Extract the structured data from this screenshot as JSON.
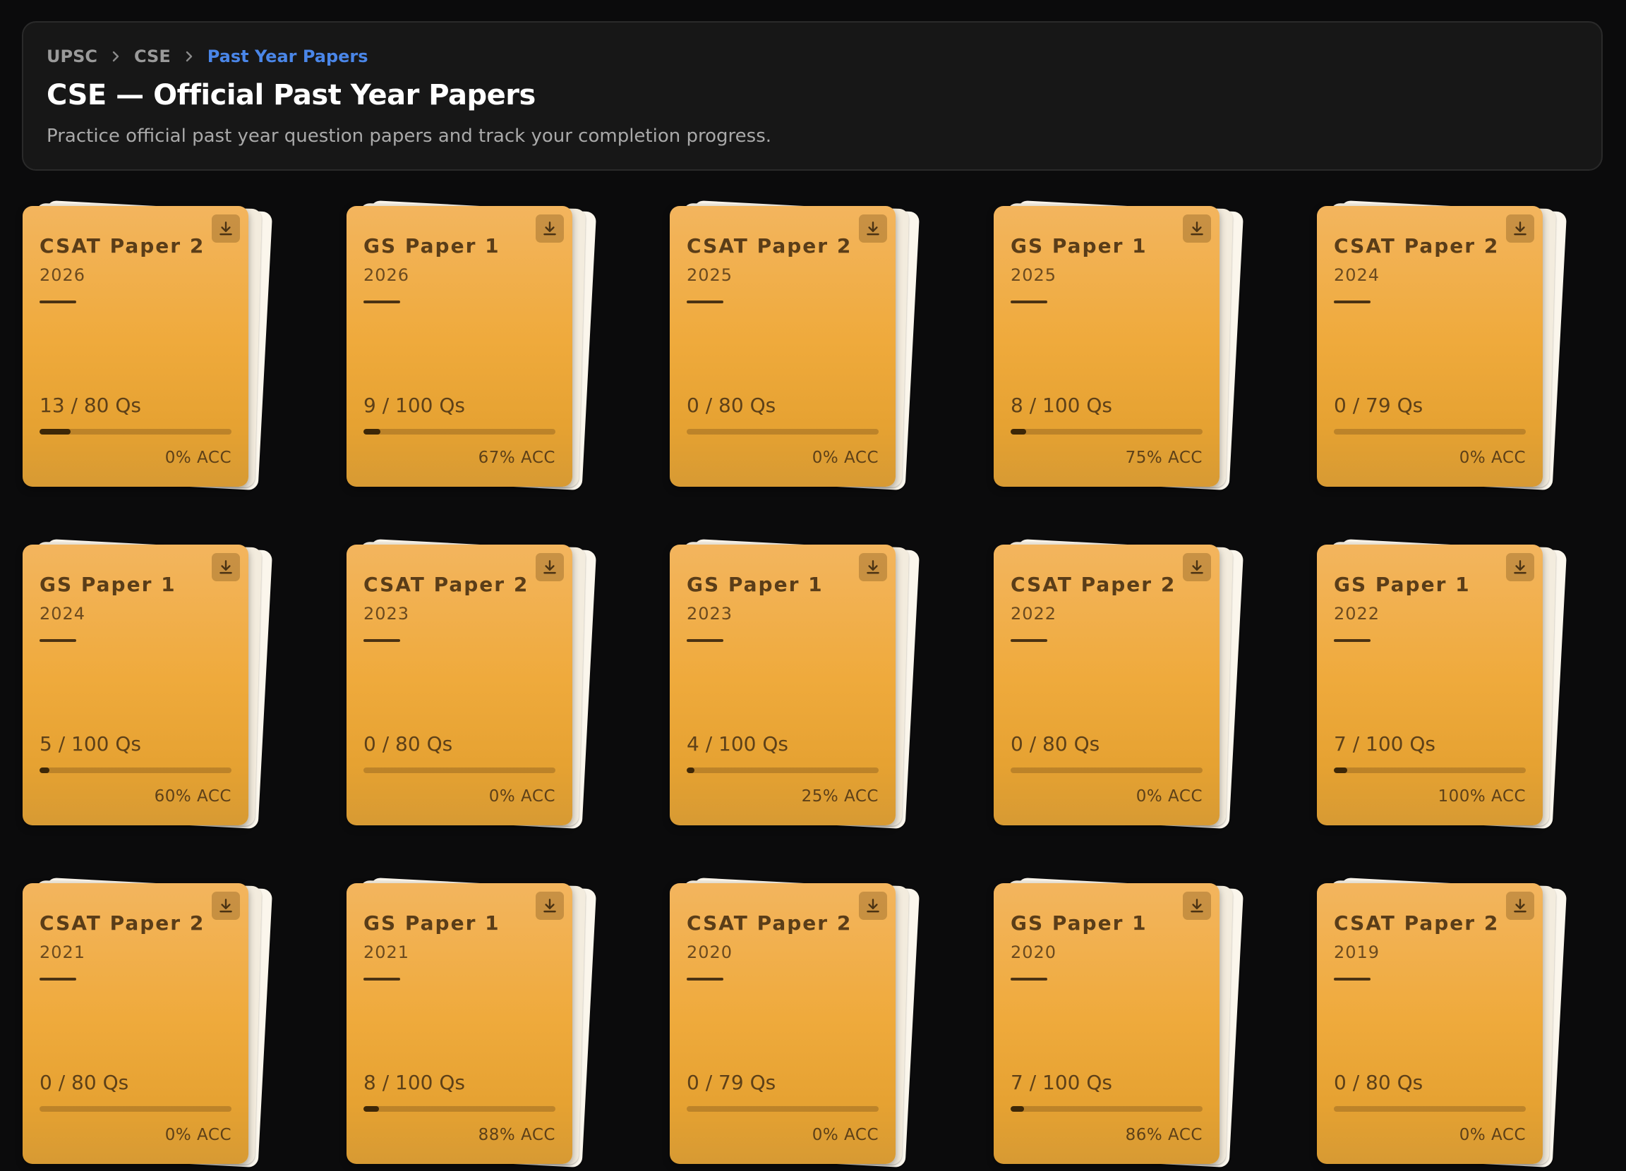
{
  "breadcrumb": [
    "UPSC",
    "CSE",
    "Past Year Papers"
  ],
  "page": {
    "title": "CSE — Official Past Year Papers",
    "subtitle": "Practice official past year question papers and track your completion progress."
  },
  "colors": {
    "accent": "#4a86e8",
    "card": "#efaa3c",
    "background": "#0b0b0c"
  },
  "icons": {
    "breadcrumb_separator": "chevron-right-icon",
    "download": "download-icon"
  },
  "papers": [
    {
      "name": "CSAT Paper 2",
      "year": "2026",
      "attempted": 13,
      "total": 80,
      "questions": "13 / 80 Qs",
      "accuracy": "0% ACC"
    },
    {
      "name": "GS Paper 1",
      "year": "2026",
      "attempted": 9,
      "total": 100,
      "questions": "9 / 100 Qs",
      "accuracy": "67% ACC"
    },
    {
      "name": "CSAT Paper 2",
      "year": "2025",
      "attempted": 0,
      "total": 80,
      "questions": "0 / 80 Qs",
      "accuracy": "0% ACC"
    },
    {
      "name": "GS Paper 1",
      "year": "2025",
      "attempted": 8,
      "total": 100,
      "questions": "8 / 100 Qs",
      "accuracy": "75% ACC"
    },
    {
      "name": "CSAT Paper 2",
      "year": "2024",
      "attempted": 0,
      "total": 79,
      "questions": "0 / 79 Qs",
      "accuracy": "0% ACC"
    },
    {
      "name": "GS Paper 1",
      "year": "2024",
      "attempted": 5,
      "total": 100,
      "questions": "5 / 100 Qs",
      "accuracy": "60% ACC"
    },
    {
      "name": "CSAT Paper 2",
      "year": "2023",
      "attempted": 0,
      "total": 80,
      "questions": "0 / 80 Qs",
      "accuracy": "0% ACC"
    },
    {
      "name": "GS Paper 1",
      "year": "2023",
      "attempted": 4,
      "total": 100,
      "questions": "4 / 100 Qs",
      "accuracy": "25% ACC"
    },
    {
      "name": "CSAT Paper 2",
      "year": "2022",
      "attempted": 0,
      "total": 80,
      "questions": "0 / 80 Qs",
      "accuracy": "0% ACC"
    },
    {
      "name": "GS Paper 1",
      "year": "2022",
      "attempted": 7,
      "total": 100,
      "questions": "7 / 100 Qs",
      "accuracy": "100% ACC"
    },
    {
      "name": "CSAT Paper 2",
      "year": "2021",
      "attempted": 0,
      "total": 80,
      "questions": "0 / 80 Qs",
      "accuracy": "0% ACC"
    },
    {
      "name": "GS Paper 1",
      "year": "2021",
      "attempted": 8,
      "total": 100,
      "questions": "8 / 100 Qs",
      "accuracy": "88% ACC"
    },
    {
      "name": "CSAT Paper 2",
      "year": "2020",
      "attempted": 0,
      "total": 79,
      "questions": "0 / 79 Qs",
      "accuracy": "0% ACC"
    },
    {
      "name": "GS Paper 1",
      "year": "2020",
      "attempted": 7,
      "total": 100,
      "questions": "7 / 100 Qs",
      "accuracy": "86% ACC"
    },
    {
      "name": "CSAT Paper 2",
      "year": "2019",
      "attempted": 0,
      "total": 80,
      "questions": "0 / 80 Qs",
      "accuracy": "0% ACC"
    }
  ]
}
